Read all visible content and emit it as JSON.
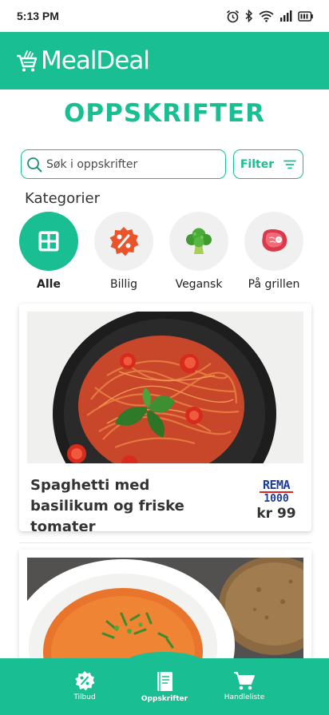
{
  "status_bar": {
    "time": "5:13 PM"
  },
  "header": {
    "brand": "MealDeal"
  },
  "page": {
    "title": "OPPSKRIFTER"
  },
  "search": {
    "placeholder": "Søk i oppskrifter",
    "value": ""
  },
  "filter": {
    "label": "Filter"
  },
  "categories": {
    "heading": "Kategorier",
    "items": [
      {
        "label": "Alle",
        "icon": "grid-icon",
        "active": true
      },
      {
        "label": "Billig",
        "icon": "discount-badge-icon",
        "active": false
      },
      {
        "label": "Vegansk",
        "icon": "broccoli-icon",
        "active": false
      },
      {
        "label": "På grillen",
        "icon": "steak-icon",
        "active": false
      }
    ]
  },
  "recipes": [
    {
      "title": "Spaghetti med basilikum og friske tomater",
      "store": {
        "line1": "REMA",
        "line2": "1000"
      },
      "price": "kr 99",
      "image": "spaghetti-with-basil-and-tomatoes"
    },
    {
      "title": "",
      "image": "tomato-soup-with-herbs"
    }
  ],
  "bottom_nav": {
    "items": [
      {
        "label": "Tilbud",
        "icon": "discount-badge-icon",
        "active": false
      },
      {
        "label": "Oppskrifter",
        "icon": "recipe-book-icon",
        "active": true
      },
      {
        "label": "Handleliste",
        "icon": "cart-icon",
        "active": false
      }
    ]
  },
  "colors": {
    "accent": "#19bf92",
    "category_inactive_bg": "#f0f0f0",
    "discount_red": "#e9542b",
    "store_blue": "#1b3b9c",
    "store_red": "#e2231a"
  }
}
